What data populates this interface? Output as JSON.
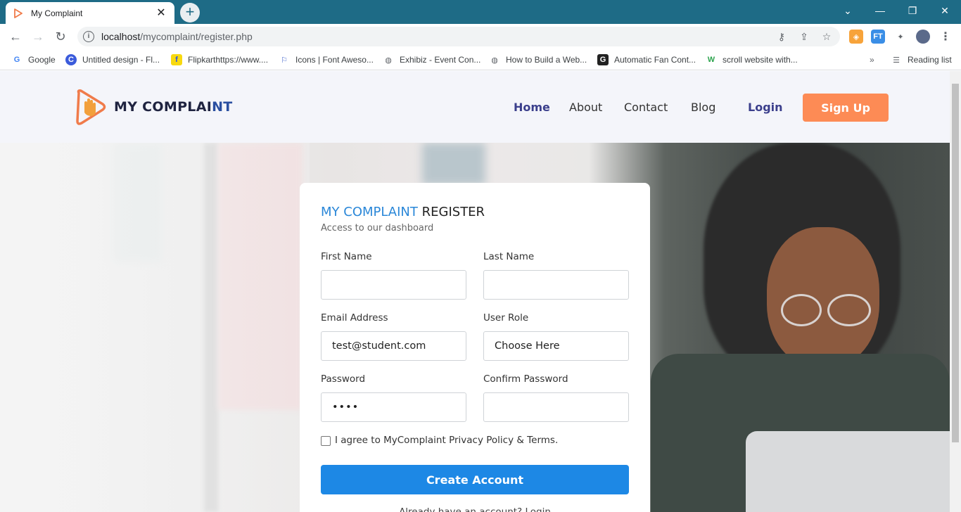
{
  "browser": {
    "tab_title": "My Complaint",
    "url_host": "localhost",
    "url_path": "/mycomplaint/register.php",
    "bookmarks": [
      {
        "label": "Google",
        "icon": "google-icon"
      },
      {
        "label": "Untitled design - Fl...",
        "icon": "canva-icon"
      },
      {
        "label": "Flipkarthttps://www....",
        "icon": "flipkart-icon"
      },
      {
        "label": "Icons | Font Aweso...",
        "icon": "flag-icon"
      },
      {
        "label": "Exhibiz - Event Con...",
        "icon": "globe-icon"
      },
      {
        "label": "How to Build a Web...",
        "icon": "globe-icon"
      },
      {
        "label": "Automatic Fan Cont...",
        "icon": "g-icon"
      },
      {
        "label": "scroll website with...",
        "icon": "w-icon"
      }
    ],
    "reading_list": "Reading list"
  },
  "header": {
    "brand_main": "MY COMPLAI",
    "brand_highlight": "NT",
    "nav": [
      "Home",
      "About",
      "Contact",
      "Blog"
    ],
    "login": "Login",
    "signup": "Sign Up"
  },
  "form": {
    "title_blue": "MY COMPLAINT",
    "title_rest": " REGISTER",
    "subtitle": "Access to our dashboard",
    "first_name_label": "First Name",
    "first_name_value": "",
    "last_name_label": "Last Name",
    "last_name_value": "",
    "email_label": "Email Address",
    "email_value": "test@student.com",
    "role_label": "User Role",
    "role_value": "Choose Here",
    "password_label": "Password",
    "password_value": "••••",
    "confirm_label": "Confirm Password",
    "confirm_value": "",
    "agree_text": "I agree to MyComplaint Privacy Policy & Terms.",
    "submit": "Create Account",
    "already": "Already have an account? Login"
  },
  "colors": {
    "chrome_tabbar": "#1e6b86",
    "accent_blue": "#1d88e5",
    "signup_orange": "#fd8b55",
    "nav_active": "#3b3f8c"
  }
}
